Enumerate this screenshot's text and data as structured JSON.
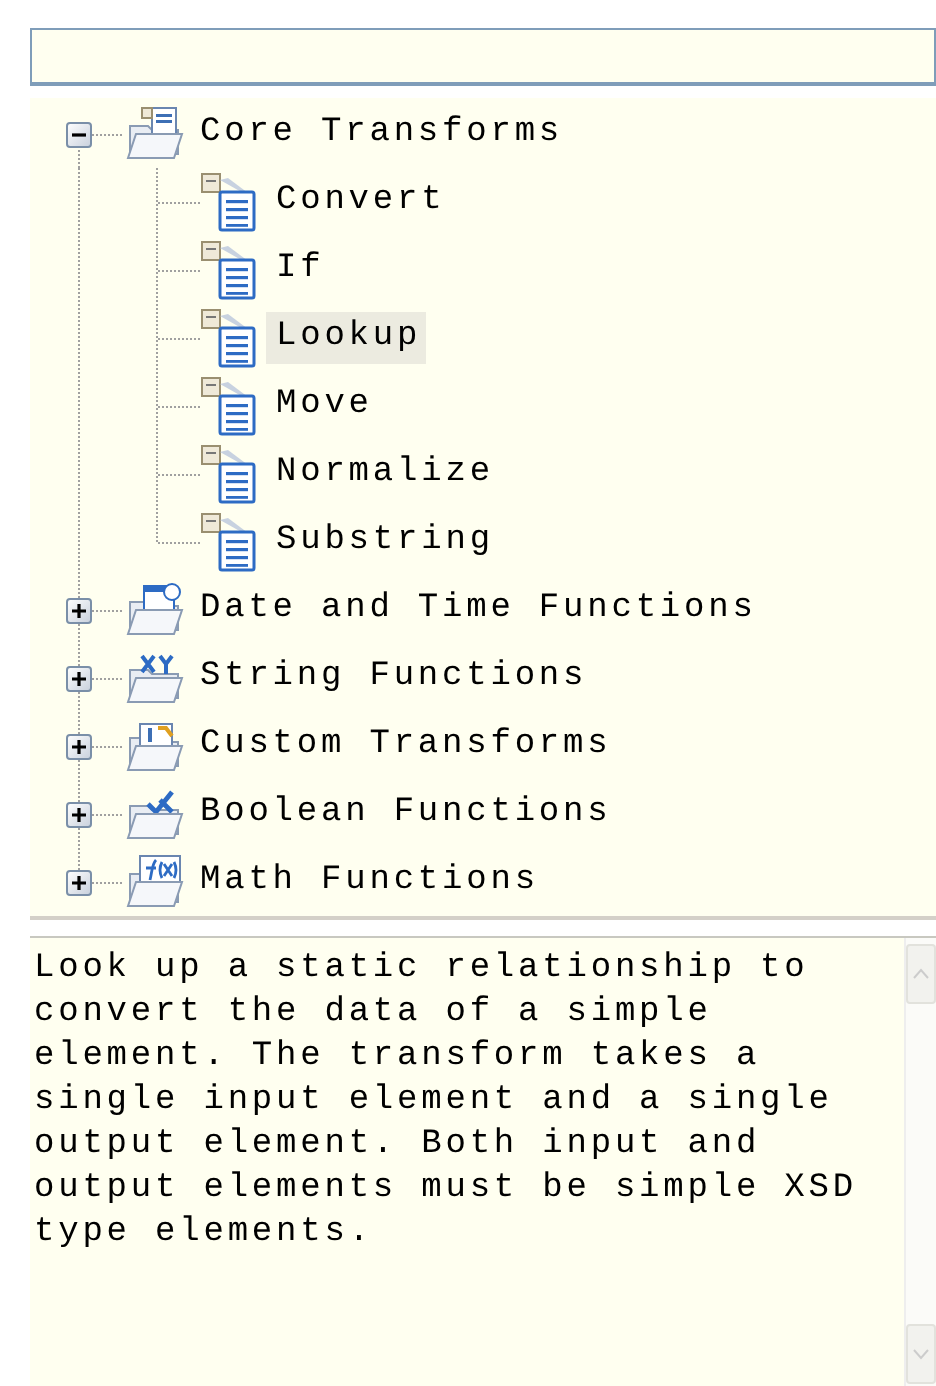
{
  "filter_field": {
    "has_focus": false
  },
  "tree": [
    {
      "label": "Core Transforms",
      "expanded": true,
      "selected": false,
      "children": [
        {
          "label": "Convert",
          "selected": false
        },
        {
          "label": "If",
          "selected": false
        },
        {
          "label": "Lookup",
          "selected": true
        },
        {
          "label": "Move",
          "selected": false
        },
        {
          "label": "Normalize",
          "selected": false
        },
        {
          "label": "Substring",
          "selected": false
        }
      ]
    },
    {
      "label": "Date and Time Functions",
      "expanded": false,
      "selected": false
    },
    {
      "label": "String Functions",
      "expanded": false,
      "selected": false
    },
    {
      "label": "Custom Transforms",
      "expanded": false,
      "selected": false
    },
    {
      "label": "Boolean Functions",
      "expanded": false,
      "selected": false
    },
    {
      "label": "Math Functions",
      "expanded": false,
      "selected": false
    }
  ],
  "description": {
    "text": "Look up a static relationship to convert the data of a simple element. The transform takes a single input element and a single output element. Both input and output elements must be simple XSD type elements."
  }
}
